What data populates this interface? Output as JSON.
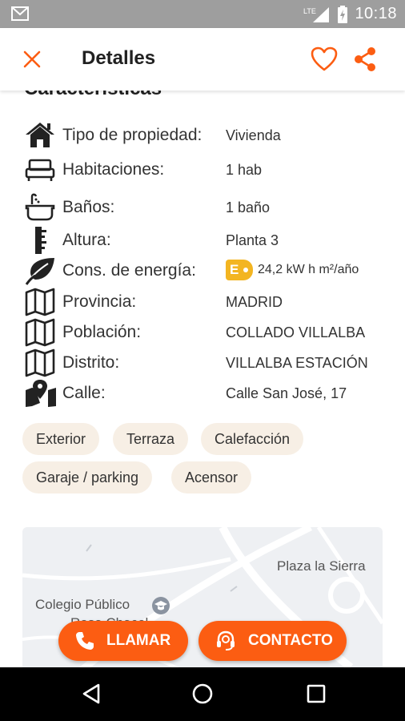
{
  "status_bar": {
    "network": "LTE",
    "time": "10:18"
  },
  "app_bar": {
    "title": "Detalles"
  },
  "section": {
    "title": "Características"
  },
  "features": [
    {
      "icon": "house-icon",
      "label": "Tipo de propiedad:",
      "value": "Vivienda"
    },
    {
      "icon": "bed-icon",
      "label": "Habitaciones:",
      "value": "1 hab"
    },
    {
      "icon": "bathtub-icon",
      "label": "Baños:",
      "value": "1 baño"
    },
    {
      "icon": "ruler-icon",
      "label": "Altura:",
      "value": "Planta 3"
    },
    {
      "icon": "leaf-icon",
      "label": "Cons. de energía:",
      "value": "24,2 kW h m²/año",
      "energy_class": "E"
    },
    {
      "icon": "map-icon",
      "label": "Provincia:",
      "value": "MADRID"
    },
    {
      "icon": "map-icon",
      "label": "Población:",
      "value": "COLLADO VILLALBA"
    },
    {
      "icon": "map-icon",
      "label": "Distrito:",
      "value": "VILLALBA ESTACIÓN"
    },
    {
      "icon": "map-pin-icon",
      "label": "Calle:",
      "value": "Calle San José, 17"
    }
  ],
  "tags": [
    "Exterior",
    "Terraza",
    "Calefacción",
    "Garaje / parking",
    "Acensor"
  ],
  "map": {
    "labels": [
      "Plaza la Sierra",
      "Colegio Público",
      "Rosa Chacel"
    ]
  },
  "buttons": {
    "call": "LLAMAR",
    "contact": "CONTACTO"
  },
  "colors": {
    "accent": "#fc5d12",
    "energy": "#f3b521",
    "chip_bg": "#f7efe5"
  }
}
